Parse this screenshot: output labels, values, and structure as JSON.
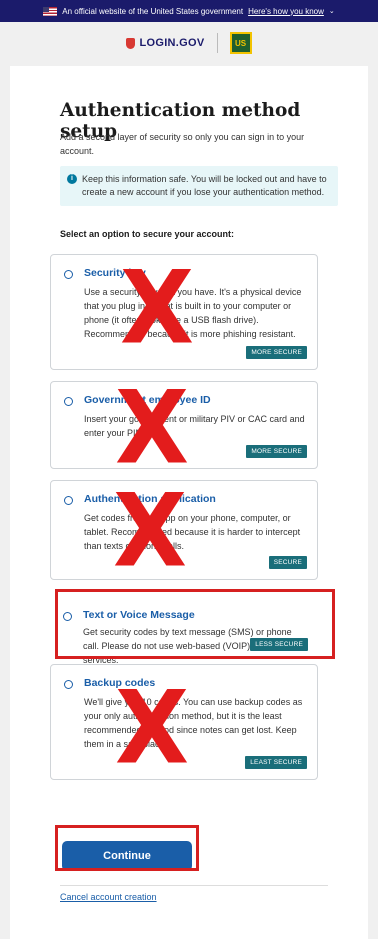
{
  "gov_banner": {
    "text": "An official website of the United States government",
    "link": "Here's how you know"
  },
  "header": {
    "logo_text": "LOGIN.GOV",
    "agency_label": "US"
  },
  "page": {
    "title": "Authentication method setup",
    "intro": "Add a second layer of security so only you can sign in to your account.",
    "alert": "Keep this information safe. You will be locked out and have to create a new account if you lose your authentication method.",
    "select_label": "Select an option to secure your account:"
  },
  "options": [
    {
      "title": "Security key",
      "description": "Use a security key that you have. It's a physical device that you plug in or that is built in to your computer or phone (it often looks like a USB flash drive). Recommended because it is more phishing resistant.",
      "badge": "MORE SECURE",
      "crossed_out": true
    },
    {
      "title": "Government employee ID",
      "description": "Insert your government or military PIV or CAC card and enter your PIN.",
      "badge": "MORE SECURE",
      "crossed_out": true
    },
    {
      "title": "Authentication application",
      "description": "Get codes from an app on your phone, computer, or tablet. Recommended because it is harder to intercept than texts or phone calls.",
      "badge": "SECURE",
      "crossed_out": true
    },
    {
      "title": "Text or Voice Message",
      "description": "Get security codes by text message (SMS) or phone call. Please do not use web-based (VOIP) phone services.",
      "badge": "LESS SECURE",
      "crossed_out": false
    },
    {
      "title": "Backup codes",
      "description": "We'll give you 10 codes. You can use backup codes as your only authentication method, but it is the least recommended method since notes can get lost. Keep them in a safe place.",
      "badge": "LEAST SECURE",
      "crossed_out": true
    }
  ],
  "annotation": {
    "cross_mark": "X"
  },
  "actions": {
    "continue_label": "Continue",
    "cancel_label": "Cancel account creation"
  },
  "colors": {
    "primary": "#1a5ea8",
    "badge": "#1a6e7a",
    "annotation_red": "#d62020"
  }
}
